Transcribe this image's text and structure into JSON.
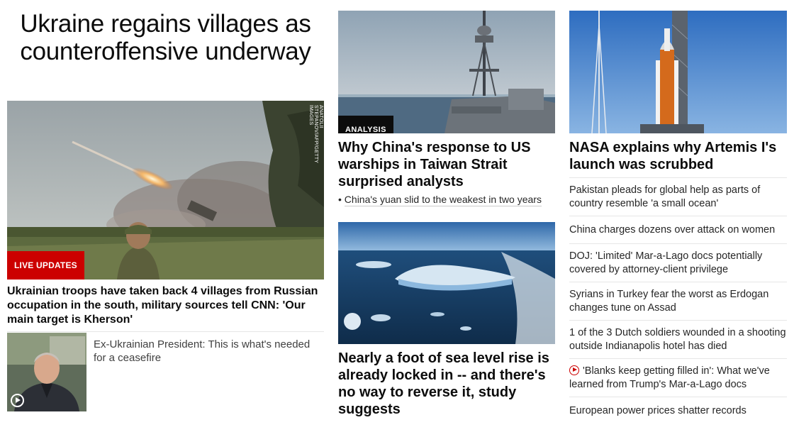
{
  "hero": {
    "title": "Ukraine regains villages as counteroffensive underway",
    "image_credit": "ANATOLII STEPANOV/AFP/GETTY IMAGES",
    "badge": "LIVE UPDATES",
    "headline": "Ukrainian troops have taken back 4 villages from Russian occupation in the south, military sources tell CNN: 'Our main target is Kherson'",
    "sub_story": "Ex-Ukrainian President: This is what's needed for a ceasefire"
  },
  "middle": {
    "story1": {
      "badge": "ANALYSIS",
      "headline": "Why China's response to US warships in Taiwan Strait surprised analysts",
      "bullet": "China's yuan slid to the weakest in two years"
    },
    "story2": {
      "headline": "Nearly a foot of sea level rise is already locked in -- and there's no way to reverse it, study suggests"
    }
  },
  "right": {
    "headline": "NASA explains why Artemis I's launch was scrubbed",
    "items": [
      "Pakistan pleads for global help as parts of country resemble 'a small ocean'",
      "China charges dozens over attack on women",
      "DOJ: 'Limited' Mar-a-Lago docs potentially covered by attorney-client privilege",
      "Syrians in Turkey fear the worst as Erdogan changes tune on Assad",
      "1 of the 3 Dutch soldiers wounded in a shooting outside Indianapolis hotel has died",
      "'Blanks keep getting filled in': What we've learned from Trump's Mar-a-Lago docs",
      "European power prices shatter records"
    ]
  },
  "colors": {
    "live_badge": "#cc0000",
    "analysis_badge": "#0c0c0c",
    "video_icon": "#cc0000",
    "divider": "#e6e6e6"
  }
}
